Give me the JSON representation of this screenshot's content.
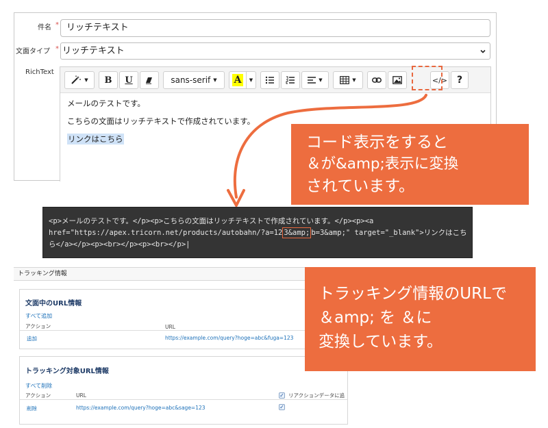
{
  "form": {
    "subject_label": "件名",
    "subject_value": "リッチテキスト",
    "doc_type_label": "文面タイプ",
    "doc_type_value": "リッチテキスト",
    "richtext_label": "RichText",
    "required_mark": "*"
  },
  "toolbar": {
    "bold": "B",
    "underline": "U",
    "font_family": "sans-serif",
    "font_color": "A",
    "codeview": "</>",
    "help": "?"
  },
  "editor": {
    "line1": "メールのテストです。",
    "line2": "こちらの文面はリッチテキストで作成されています。",
    "link_text": "リンクはこちら"
  },
  "callout1": {
    "line1": "コード表示をすると",
    "line2": "＆が&amp;表示に変換",
    "line3": "されています。"
  },
  "code": {
    "line1": "<p>メールのテストです。</p><p>こちらの文面はリッチテキストで作成されています。</p><p><a",
    "line2_pre": "href=\"https://apex.tricorn.net/products/autobahn/?a=12",
    "line2_hl": "3&amp;",
    "line2_post": "b=3&amp;\" target=\"_blank\">リンクはこち",
    "line3": "ら</a></p><p><br></p><p><br></p>|"
  },
  "tracking": {
    "header": "トラッキング情報",
    "card1": {
      "title": "文面中のURL情報",
      "add_all": "すべて追加",
      "col_action": "アクション",
      "col_url": "URL",
      "row_action": "追加",
      "row_url": "https://example.com/query?hoge=abc&fuga=123"
    },
    "card2": {
      "title": "トラッキング対象URL情報",
      "delete_all": "すべて削除",
      "col_action": "アクション",
      "col_url": "URL",
      "col_reaction": "リアクションデータに追",
      "row_action": "削除",
      "row_url": "https://example.com/query?hoge=abc&sage=123"
    }
  },
  "callout2": {
    "line1": "トラッキング情報のURLで",
    "line2": "＆amp; を ＆に",
    "line3": "変換しています。"
  },
  "colors": {
    "accent": "#ed6d3f",
    "link": "#1a6fb8",
    "code_bg": "#343434",
    "title_navy": "#1d3a66"
  }
}
